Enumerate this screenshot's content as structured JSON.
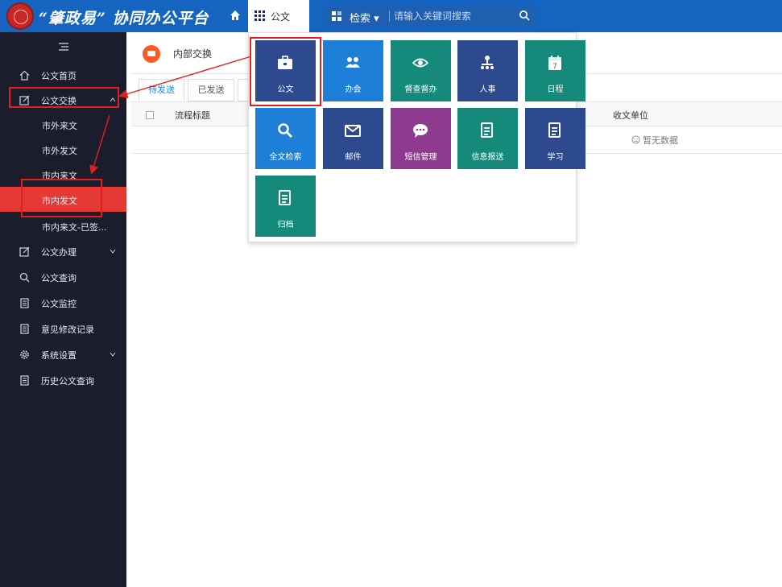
{
  "header": {
    "app_title": "“肇政易” 协同办公平台",
    "apps_label": "公文",
    "search_scope": "检索",
    "search_placeholder": "请输入关键词搜索"
  },
  "sidebar": {
    "items": [
      {
        "label": "公文首页",
        "icon": "home-outline-icon"
      },
      {
        "label": "公文交换",
        "icon": "edit-square-icon",
        "expanded": true
      },
      {
        "label": "公文办理",
        "icon": "edit-square-icon",
        "expandable": true
      },
      {
        "label": "公文查询",
        "icon": "search-icon"
      },
      {
        "label": "公文监控",
        "icon": "document-icon"
      },
      {
        "label": "意见修改记录",
        "icon": "document-icon"
      },
      {
        "label": "系统设置",
        "icon": "gear-icon",
        "expandable": true
      },
      {
        "label": "历史公文查询",
        "icon": "document-icon"
      }
    ],
    "subitems": [
      {
        "label": "市外来文"
      },
      {
        "label": "市外发文"
      },
      {
        "label": "市内来文"
      },
      {
        "label": "市内发文",
        "active": true
      },
      {
        "label": "市内来文-已签..."
      }
    ]
  },
  "content": {
    "module_title": "内部交换",
    "tabs": [
      "待发送",
      "已发送"
    ],
    "table": {
      "col_title": "流程标题",
      "col_unit": "收文单位",
      "empty_text": "暂无数据"
    }
  },
  "launcher": {
    "tiles": [
      {
        "label": "公文",
        "icon": "briefcase-icon",
        "color": "#2d4a8e",
        "selected": true
      },
      {
        "label": "办会",
        "icon": "people-icon",
        "color": "#1e7fd8"
      },
      {
        "label": "督查督办",
        "icon": "eye-icon",
        "color": "#15897a"
      },
      {
        "label": "人事",
        "icon": "org-chart-icon",
        "color": "#2d4a8e"
      },
      {
        "label": "日程",
        "icon": "calendar-icon",
        "color": "#15897a",
        "icon_text": "7"
      },
      {
        "label": "全文检索",
        "icon": "search-icon",
        "color": "#1e7fd8"
      },
      {
        "label": "邮件",
        "icon": "mail-icon",
        "color": "#2d4a8e"
      },
      {
        "label": "短信管理",
        "icon": "chat-icon",
        "color": "#8e3a8e"
      },
      {
        "label": "信息报送",
        "icon": "document-icon",
        "color": "#15897a"
      },
      {
        "label": "学习",
        "icon": "document-icon",
        "color": "#2d4a8e"
      },
      {
        "label": "归档",
        "icon": "document-icon",
        "color": "#15897a"
      }
    ]
  },
  "colors": {
    "topbar": "#1565c0",
    "sidebar": "#1b1d2c",
    "active_item": "#e53935",
    "annotation": "#e02020",
    "tab_active": "#1e88e5"
  }
}
